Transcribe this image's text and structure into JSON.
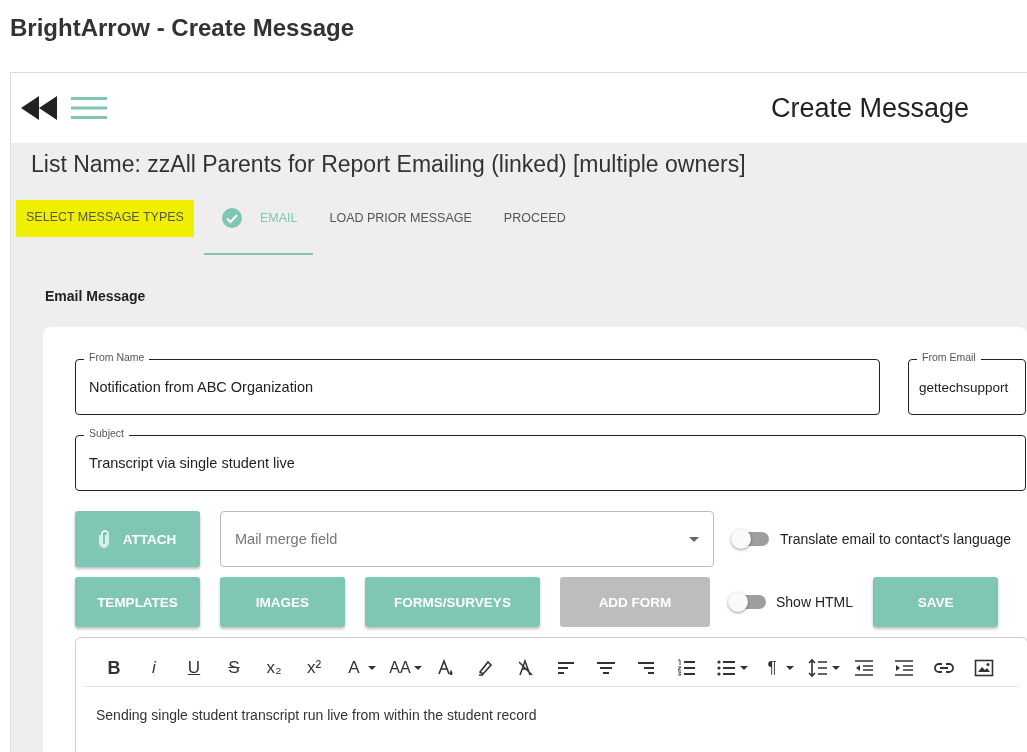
{
  "page_title": "BrightArrow - Create Message",
  "header": {
    "title": "Create Message"
  },
  "list_name": "List Name: zzAll Parents for Report Emailing (linked) [multiple owners]",
  "steps": [
    {
      "label": "SELECT MESSAGE TYPES",
      "selected": false,
      "highlighted": true,
      "done": false
    },
    {
      "label": "EMAIL",
      "selected": true,
      "highlighted": false,
      "done": true
    },
    {
      "label": "LOAD PRIOR MESSAGE",
      "selected": false,
      "highlighted": false,
      "done": false
    },
    {
      "label": "PROCEED",
      "selected": false,
      "highlighted": false,
      "done": false
    }
  ],
  "section_title": "Email Message",
  "from_name": {
    "label": "From Name",
    "value": "Notification from ABC Organization"
  },
  "from_email": {
    "label": "From Email",
    "value": "gettechsupport"
  },
  "subject": {
    "label": "Subject",
    "value": "Transcript via single student live"
  },
  "attach_button": "ATTACH",
  "merge_field": {
    "placeholder": "Mail merge field"
  },
  "translate_toggle": {
    "label": "Translate email to contact's language",
    "on": false
  },
  "buttons": [
    {
      "label": "TEMPLATES",
      "disabled": false
    },
    {
      "label": "IMAGES",
      "disabled": false
    },
    {
      "label": "FORMS/SURVEYS",
      "disabled": false
    },
    {
      "label": "ADD FORM",
      "disabled": true
    }
  ],
  "html_toggle": {
    "label": "Show HTML",
    "on": false
  },
  "save_button": "SAVE",
  "toolbar": [
    {
      "kind": "bold",
      "label": "B"
    },
    {
      "kind": "italic",
      "label": "i"
    },
    {
      "kind": "underline",
      "label": "U"
    },
    {
      "kind": "strike",
      "label": "S"
    },
    {
      "kind": "plain",
      "label": "x₂"
    },
    {
      "kind": "plain",
      "label": "x²"
    },
    {
      "kind": "plain",
      "label": "A",
      "dropdown": true
    },
    {
      "kind": "small",
      "label": "AA",
      "dropdown": true
    },
    {
      "kind": "fill"
    },
    {
      "kind": "highlighter"
    },
    {
      "kind": "clear"
    },
    {
      "kind": "align-left"
    },
    {
      "kind": "align-center"
    },
    {
      "kind": "align-right"
    },
    {
      "kind": "ordered-list"
    },
    {
      "kind": "bullet-list",
      "dropdown": true
    },
    {
      "kind": "plain",
      "label": "¶",
      "dropdown": true
    },
    {
      "kind": "line-height",
      "dropdown": true
    },
    {
      "kind": "outdent"
    },
    {
      "kind": "indent"
    },
    {
      "kind": "link"
    },
    {
      "kind": "image"
    }
  ],
  "body_text": "Sending single student transcript run live from within the student record"
}
